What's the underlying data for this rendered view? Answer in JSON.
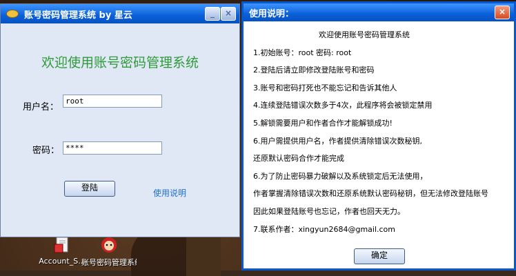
{
  "desktop": {
    "icons": [
      {
        "label": "Account_S...",
        "icon": "document-icon"
      },
      {
        "label": "账号密码管理系统1",
        "icon": "cartoon-app-icon"
      }
    ]
  },
  "login_window": {
    "title": "账号密码管理系统  by 星云",
    "controls": {
      "minimize": "_",
      "close": "×"
    },
    "welcome": "欢迎使用账号密码管理系统",
    "username_label": "用户名：",
    "username_value": "root",
    "password_label": "密码：",
    "password_value": "****",
    "login_button": "登陆",
    "help_link": "使用说明"
  },
  "help_window": {
    "title": "使用说明：",
    "close": "×",
    "lines": [
      "欢迎使用账号密码管理系统",
      "1.初始账号：root 密码: root",
      "2.登陆后请立即修改登陆账号和密码",
      "3.账号和密码打死也不能忘记和告诉其他人",
      "4.连续登陆错误次数多于4次，此程序将会被锁定禁用",
      "5.解锁需要用户和作者合作才能解锁成功!",
      "6.用户需提供用户名，作者提供清除错误次数秘钥,",
      "还原默认密码合作才能完成",
      "6.为了防止密码暴力破解以及系统锁定后无法使用，",
      "作者掌握清除错误次数和还原系统默认密码秘钥，但无法修改登陆账号",
      "因此如果登陆账号也忘记，作者也回天无力。",
      "7.联系作者：xingyun2684@gmail.com"
    ],
    "ok_button": "确定"
  },
  "colors": {
    "titlebar": "#0a5fd8",
    "welcome_text": "#2f9a3a",
    "link": "#1e6fd0"
  }
}
